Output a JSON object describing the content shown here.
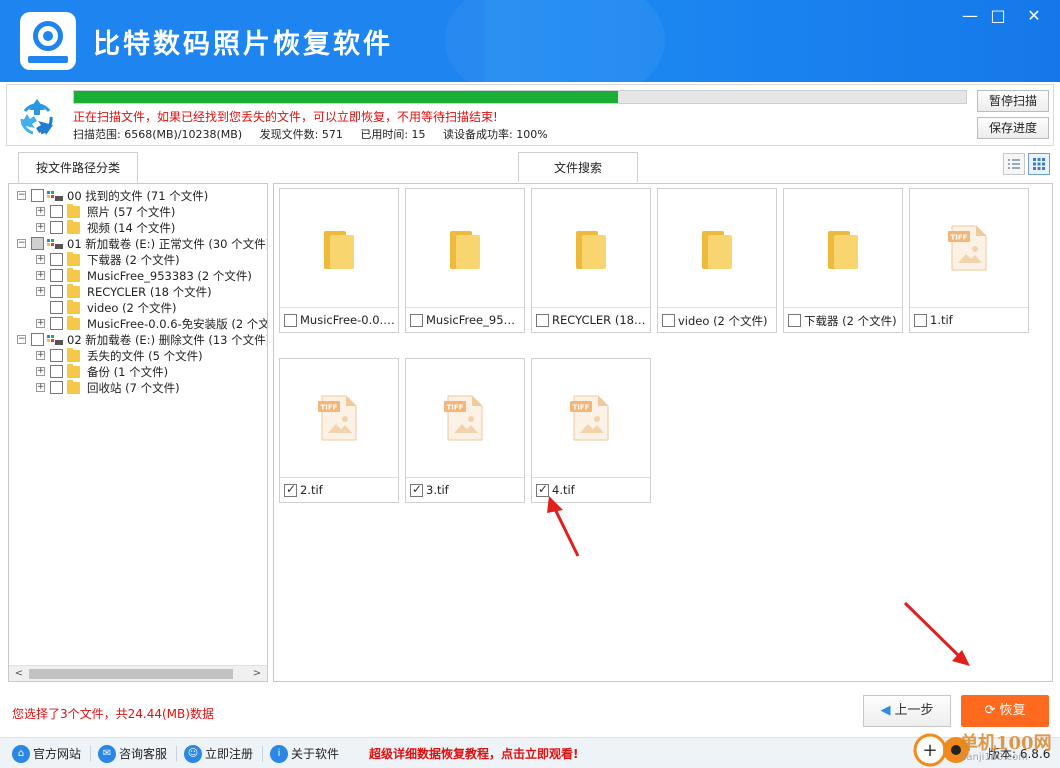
{
  "app": {
    "title": "比特数码照片恢复软件"
  },
  "window_controls": {
    "minimize": "—",
    "maximize": "□",
    "close": "✕"
  },
  "scan": {
    "progress_fraction": 0.61,
    "message": "正在扫描文件，如果已经找到您丢失的文件，可以立即恢复，不用等待扫描结束!",
    "range": "扫描范围: 6568(MB)/10238(MB)",
    "found": "发现文件数: 571",
    "elapsed": "已用时间: 15",
    "read_rate": "读设备成功率: 100%",
    "pause_label": "暂停扫描",
    "save_label": "保存进度"
  },
  "tabs": {
    "by_path": "按文件路径分类",
    "search": "文件搜索"
  },
  "tree": [
    {
      "label": "00 找到的文件 (71 个文件)",
      "level": 0,
      "icon": "drive-icon",
      "checked": "none"
    },
    {
      "label": "照片    (57 个文件)",
      "level": 1,
      "icon": "folder-icon",
      "checked": "none"
    },
    {
      "label": "视频    (14 个文件)",
      "level": 1,
      "icon": "folder-icon",
      "checked": "none"
    },
    {
      "label": "01 新加载卷 (E:) 正常文件 (30 个文件)",
      "level": 0,
      "icon": "drive-icon",
      "checked": "partial"
    },
    {
      "label": "下载器    (2 个文件)",
      "level": 1,
      "icon": "folder-icon",
      "checked": "none"
    },
    {
      "label": "MusicFree_953383    (2 个文件)",
      "level": 1,
      "icon": "folder-icon",
      "checked": "none"
    },
    {
      "label": "RECYCLER    (18 个文件)",
      "level": 1,
      "icon": "folder-icon",
      "checked": "none"
    },
    {
      "label": "video    (2 个文件)",
      "level": 1,
      "icon": "folder-icon",
      "checked": "none",
      "no_expander": true
    },
    {
      "label": "MusicFree-0.0.6-免安装版    (2 个文",
      "level": 1,
      "icon": "folder-icon",
      "checked": "none"
    },
    {
      "label": "02 新加载卷 (E:) 删除文件 (13 个文件)",
      "level": 0,
      "icon": "drive-icon",
      "checked": "none"
    },
    {
      "label": "丢失的文件    (5 个文件)",
      "level": 1,
      "icon": "folder-icon",
      "checked": "none"
    },
    {
      "label": "备份    (1 个文件)",
      "level": 1,
      "icon": "folder-icon",
      "checked": "none"
    },
    {
      "label": "回收站    (7 个文件)",
      "level": 1,
      "icon": "folder-icon",
      "checked": "none"
    }
  ],
  "files": [
    {
      "name": "MusicFree-0.0.6-...",
      "type": "folder",
      "checked": false
    },
    {
      "name": "MusicFree_95338...",
      "type": "folder",
      "checked": false
    },
    {
      "name": "RECYCLER (18 ...",
      "type": "folder",
      "checked": false
    },
    {
      "name": "video (2 个文件)",
      "type": "folder",
      "checked": false
    },
    {
      "name": "下载器 (2 个文件)",
      "type": "folder",
      "checked": false
    },
    {
      "name": "1.tif",
      "type": "tif",
      "checked": false
    },
    {
      "name": "2.tif",
      "type": "tif",
      "checked": true
    },
    {
      "name": "3.tif",
      "type": "tif",
      "checked": true
    },
    {
      "name": "4.tif",
      "type": "tif",
      "checked": true
    }
  ],
  "tif_label": "TIFF",
  "status": "您选择了3个文件，共24.44(MB)数据",
  "buttons": {
    "prev": "上一步",
    "recover": "恢复"
  },
  "footer": {
    "links": [
      {
        "label": "官方网站",
        "icon": "home-icon"
      },
      {
        "label": "咨询客服",
        "icon": "chat-icon"
      },
      {
        "label": "立即注册",
        "icon": "user-icon"
      },
      {
        "label": "关于软件",
        "icon": "info-icon"
      }
    ],
    "promo": "超级详细数据恢复教程，点击立即观看!",
    "version": "版本: 6.8.6"
  },
  "watermark": {
    "text": "单机100网",
    "sub": "danji100.com"
  },
  "colors": {
    "brand_blue": "#1d84f0",
    "progress_green": "#19ae36",
    "recover_orange": "#ff6a1e",
    "alert_red": "#e01010",
    "annotation_red": "#e0201e"
  }
}
